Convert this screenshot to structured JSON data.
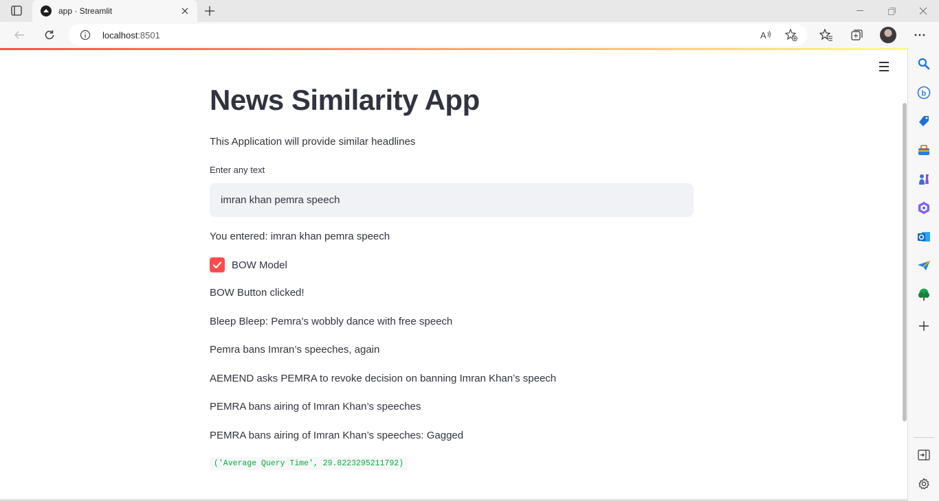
{
  "browser": {
    "tab": {
      "title": "app · Streamlit"
    },
    "address": {
      "host": "localhost",
      "port": ":8501"
    }
  },
  "page": {
    "title": "News Similarity App",
    "description": "This Application will provide similar headlines",
    "input": {
      "label": "Enter any text",
      "value": "imran khan pemra speech"
    },
    "entered_text": "You entered: imran khan pemra speech",
    "checkbox": {
      "label": "BOW Model",
      "checked": true
    },
    "status": "BOW Button clicked!",
    "results": [
      "Bleep Bleep: Pemra’s wobbly dance with free speech",
      "Pemra bans Imran’s speeches, again",
      "AEMEND asks PEMRA to revoke decision on banning Imran Khan’s speech",
      "PEMRA bans airing of Imran Khan’s speeches",
      "PEMRA bans airing of Imran Khan’s speeches: Gagged"
    ],
    "code_output": "('Average Query Time', 29.8223295211792)"
  },
  "colors": {
    "primary": "#ff4b4b",
    "text": "#31333f",
    "code_text": "#09ab3b",
    "input_bg": "#f0f2f6"
  },
  "icons": {
    "sidebar": [
      "search-icon",
      "bing-chat-icon",
      "shopping-icon",
      "tools-icon",
      "games-icon",
      "office-icon",
      "outlook-icon",
      "drop-icon",
      "tree-icon",
      "add-icon",
      "split-screen-icon",
      "settings-icon"
    ]
  }
}
